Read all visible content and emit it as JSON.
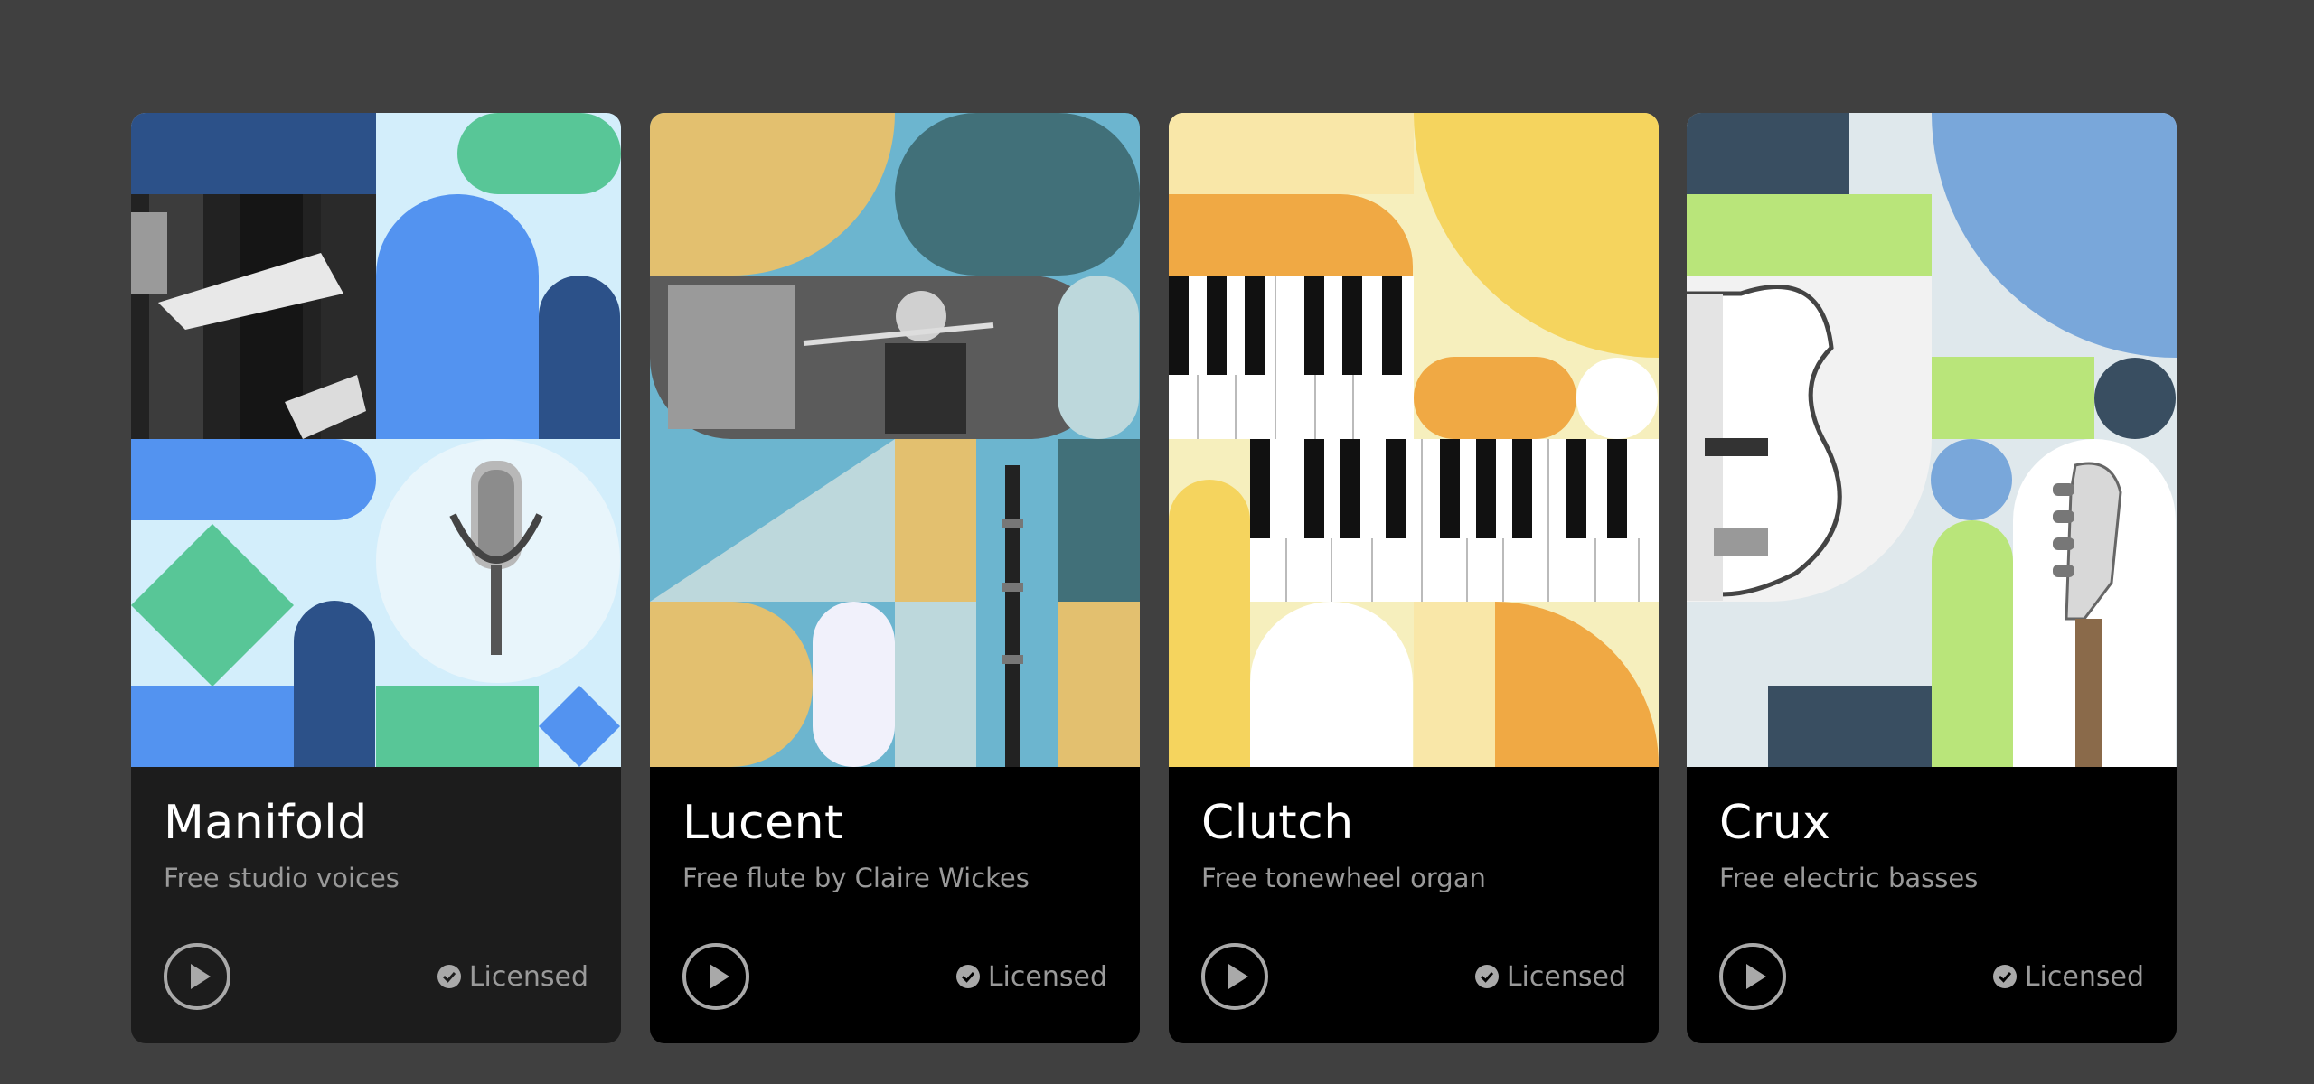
{
  "cards": [
    {
      "title": "Manifold",
      "subtitle": "Free studio voices",
      "status": "Licensed",
      "image": "choir-and-microphone-collage",
      "play_icon": "play-icon",
      "status_icon": "check-circle-icon"
    },
    {
      "title": "Lucent",
      "subtitle": "Free flute by Claire Wickes",
      "status": "Licensed",
      "image": "flutist-collage",
      "play_icon": "play-icon",
      "status_icon": "check-circle-icon"
    },
    {
      "title": "Clutch",
      "subtitle": "Free tonewheel organ",
      "status": "Licensed",
      "image": "organ-keys-collage",
      "play_icon": "play-icon",
      "status_icon": "check-circle-icon"
    },
    {
      "title": "Crux",
      "subtitle": "Free electric basses",
      "status": "Licensed",
      "image": "electric-bass-collage",
      "play_icon": "play-icon",
      "status_icon": "check-circle-icon"
    }
  ],
  "colors": {
    "page_background": "#404040",
    "card_info_background": "#000000",
    "card_info_background_hover": "#1c1c1c",
    "title_text": "#ffffff",
    "muted_text": "#9a9a9a"
  }
}
